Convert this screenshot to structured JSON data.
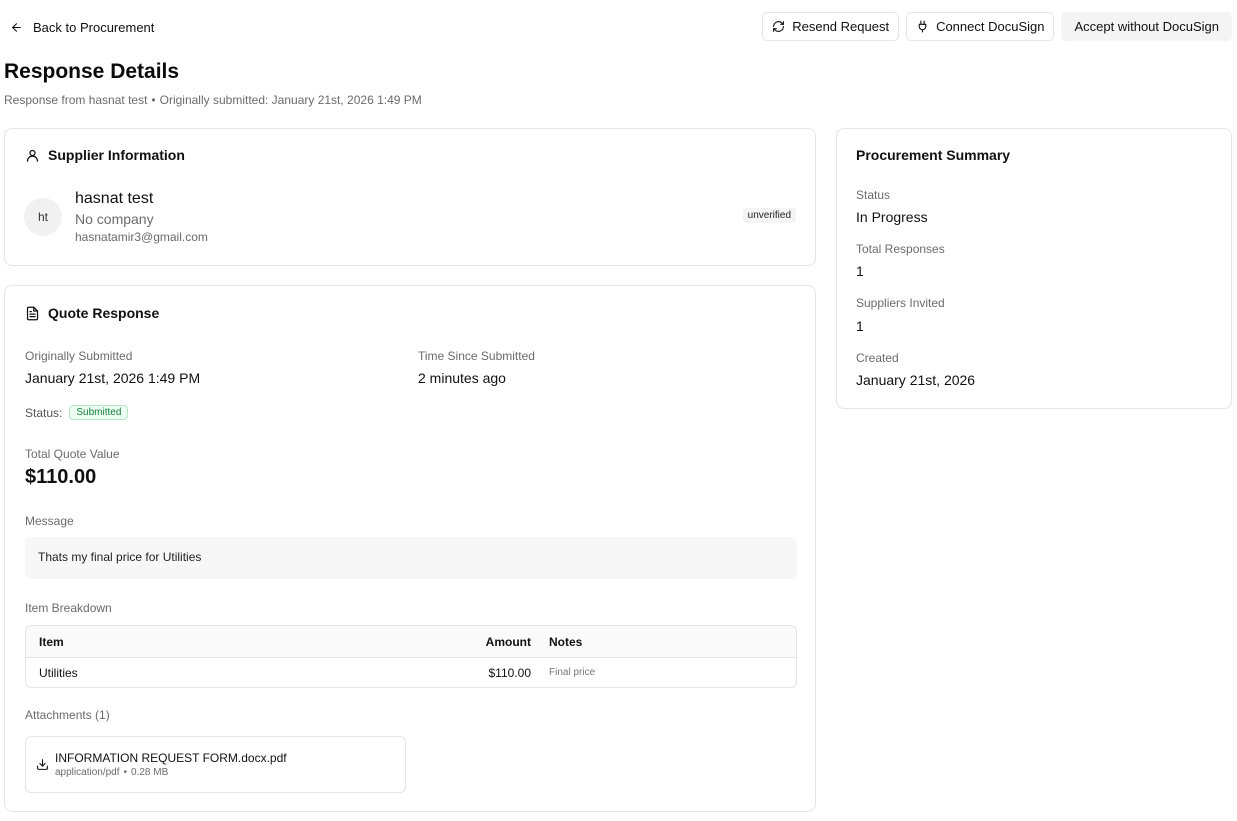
{
  "header": {
    "back_label": "Back to Procurement",
    "actions": {
      "resend": "Resend Request",
      "connect": "Connect DocuSign",
      "accept": "Accept without DocuSign"
    }
  },
  "page": {
    "title": "Response Details",
    "subtitle_from": "Response from hasnat test",
    "subtitle_sep": "•",
    "subtitle_submitted": "Originally submitted: January 21st, 2026 1:49 PM"
  },
  "supplier": {
    "section_title": "Supplier Information",
    "initials": "ht",
    "name": "hasnat test",
    "company": "No company",
    "email": "hasnatamir3@gmail.com",
    "verification": "unverified"
  },
  "quote": {
    "section_title": "Quote Response",
    "submitted_label": "Originally Submitted",
    "submitted_value": "January 21st, 2026 1:49 PM",
    "since_label": "Time Since Submitted",
    "since_value": "2 minutes ago",
    "status_label": "Status:",
    "status_value": "Submitted",
    "total_label": "Total Quote Value",
    "total_value": "$110.00",
    "message_label": "Message",
    "message_value": "Thats my final price for Utilities",
    "breakdown_label": "Item Breakdown",
    "table": {
      "headers": {
        "item": "Item",
        "amount": "Amount",
        "notes": "Notes"
      },
      "rows": [
        {
          "item": "Utilities",
          "amount": "$110.00",
          "notes": "Final price"
        }
      ]
    },
    "attachments_label": "Attachments (1)",
    "attachment": {
      "name": "INFORMATION REQUEST FORM.docx.pdf",
      "type": "application/pdf",
      "sep": "•",
      "size": "0.28 MB"
    }
  },
  "summary": {
    "section_title": "Procurement Summary",
    "status_label": "Status",
    "status_value": "In Progress",
    "responses_label": "Total Responses",
    "responses_value": "1",
    "invited_label": "Suppliers Invited",
    "invited_value": "1",
    "created_label": "Created",
    "created_value": "January 21st, 2026"
  },
  "icons": {
    "back": "arrow-left-icon",
    "resend": "refresh-icon",
    "connect": "plug-icon",
    "supplier": "user-icon",
    "quote": "file-text-icon",
    "download": "download-icon"
  },
  "colors": {
    "status_badge_bg": "#ecfdf3",
    "status_badge_text": "#15803d"
  }
}
